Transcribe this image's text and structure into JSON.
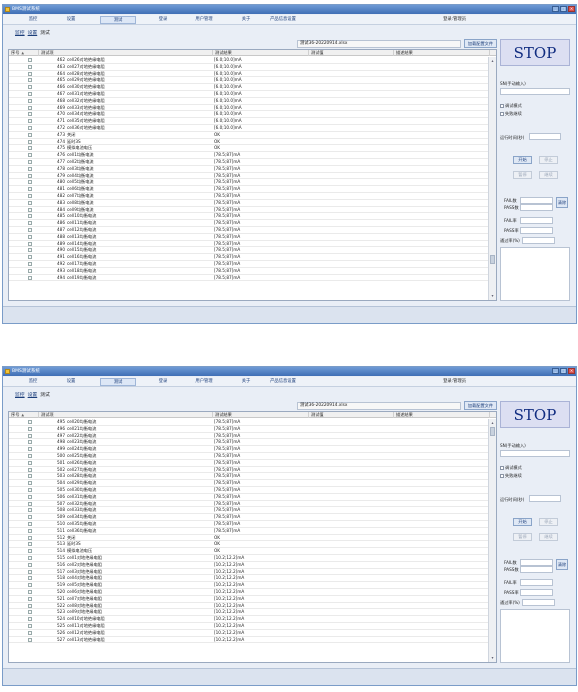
{
  "windows": [
    {
      "title": "BMS测试系统",
      "controls": [
        "_",
        "□",
        "×"
      ],
      "menu": [
        "监控",
        "设置",
        "测试",
        "登录",
        "用户管理",
        "关于",
        "产品信息设置"
      ],
      "active_menu_index": 2,
      "login": "登录:管理员",
      "tabs": [
        "监控",
        "设置",
        "测试"
      ],
      "file": "测试36-20220914.xlsx",
      "load_btn": "加载配置文件",
      "columns": [
        "序号",
        "测试项",
        "测试结果",
        "测试值",
        "描述结果"
      ],
      "rows": [
        {
          "no": "462",
          "name": "cell26对地绝缘电阻",
          "result": "[6.0;10.0]mA"
        },
        {
          "no": "463",
          "name": "cell27对地绝缘电阻",
          "result": "[6.0;10.0]mA"
        },
        {
          "no": "464",
          "name": "cell28对地绝缘电阻",
          "result": "[6.0;10.0]mA"
        },
        {
          "no": "465",
          "name": "cell29对地绝缘电阻",
          "result": "[6.0;10.0]mA"
        },
        {
          "no": "466",
          "name": "cell30对地绝缘电阻",
          "result": "[6.0;10.0]mA"
        },
        {
          "no": "467",
          "name": "cell31对地绝缘电阻",
          "result": "[6.0;10.0]mA"
        },
        {
          "no": "468",
          "name": "cell32对地绝缘电阻",
          "result": "[6.0;10.0]mA"
        },
        {
          "no": "469",
          "name": "cell33对地绝缘电阻",
          "result": "[6.0;10.0]mA"
        },
        {
          "no": "470",
          "name": "cell34对地绝缘电阻",
          "result": "[6.0;10.0]mA"
        },
        {
          "no": "471",
          "name": "cell35对地绝缘电阻",
          "result": "[6.0;10.0]mA"
        },
        {
          "no": "472",
          "name": "cell36对地绝缘电阻",
          "result": "[6.0;10.0]mA"
        },
        {
          "no": "473",
          "name": "关闭",
          "result": "OK"
        },
        {
          "no": "474",
          "name": "延时3S",
          "result": "OK"
        },
        {
          "no": "475",
          "name": "模拟电池电压",
          "result": "OK"
        },
        {
          "no": "476",
          "name": "cell1均衡电流",
          "result": "[78.5;87]mA"
        },
        {
          "no": "477",
          "name": "cell2均衡电流",
          "result": "[78.5;87]mA"
        },
        {
          "no": "478",
          "name": "cell3均衡电流",
          "result": "[78.5;87]mA"
        },
        {
          "no": "479",
          "name": "cell4均衡电流",
          "result": "[78.5;87]mA"
        },
        {
          "no": "480",
          "name": "cell5均衡电流",
          "result": "[78.5;87]mA"
        },
        {
          "no": "481",
          "name": "cell6均衡电流",
          "result": "[78.5;87]mA"
        },
        {
          "no": "482",
          "name": "cell7均衡电流",
          "result": "[78.5;87]mA"
        },
        {
          "no": "483",
          "name": "cell8均衡电流",
          "result": "[78.5;87]mA"
        },
        {
          "no": "484",
          "name": "cell9均衡电流",
          "result": "[78.5;87]mA"
        },
        {
          "no": "485",
          "name": "cell10均衡电流",
          "result": "[78.5;87]mA"
        },
        {
          "no": "486",
          "name": "cell11均衡电流",
          "result": "[78.5;87]mA"
        },
        {
          "no": "487",
          "name": "cell12均衡电流",
          "result": "[78.5;87]mA"
        },
        {
          "no": "488",
          "name": "cell13均衡电流",
          "result": "[78.5;87]mA"
        },
        {
          "no": "489",
          "name": "cell14均衡电流",
          "result": "[78.5;87]mA"
        },
        {
          "no": "490",
          "name": "cell15均衡电流",
          "result": "[78.5;87]mA"
        },
        {
          "no": "491",
          "name": "cell16均衡电流",
          "result": "[78.5;87]mA"
        },
        {
          "no": "492",
          "name": "cell17均衡电流",
          "result": "[78.5;87]mA"
        },
        {
          "no": "493",
          "name": "cell18均衡电流",
          "result": "[78.5;87]mA"
        },
        {
          "no": "494",
          "name": "cell19均衡电流",
          "result": "[78.5;87]mA"
        }
      ],
      "side": {
        "stop": "STOP",
        "sn_label": "SN(手动输入)",
        "checkbox1": "调试模式",
        "checkbox2": "失败继续",
        "op_label": "运行时间(秒)",
        "start": "开始",
        "stop_btn": "停止",
        "pause": "暂停",
        "resume": "继续",
        "fail_count": "FAIL数",
        "pass_count": "PASS数",
        "clear": "清除",
        "fail_rate": "FAIL率",
        "pass_rate": "PASS率",
        "yield": "通过率(%)"
      }
    },
    {
      "title": "BMS测试系统",
      "controls": [
        "_",
        "□",
        "×"
      ],
      "menu": [
        "监控",
        "设置",
        "测试",
        "登录",
        "用户管理",
        "关于",
        "产品信息设置"
      ],
      "active_menu_index": 2,
      "login": "登录:管理员",
      "tabs": [
        "监控",
        "设置",
        "测试"
      ],
      "file": "测试36-20220914.xlsx",
      "load_btn": "加载配置文件",
      "columns": [
        "序号",
        "测试项",
        "测试结果",
        "测试值",
        "描述结果"
      ],
      "rows": [
        {
          "no": "495",
          "name": "cell20均衡电流",
          "result": "[78.5;87]mA"
        },
        {
          "no": "496",
          "name": "cell21均衡电流",
          "result": "[78.5;87]mA"
        },
        {
          "no": "497",
          "name": "cell22均衡电流",
          "result": "[78.5;87]mA"
        },
        {
          "no": "498",
          "name": "cell23均衡电流",
          "result": "[78.5;87]mA"
        },
        {
          "no": "499",
          "name": "cell24均衡电流",
          "result": "[78.5;87]mA"
        },
        {
          "no": "500",
          "name": "cell25均衡电流",
          "result": "[78.5;87]mA"
        },
        {
          "no": "501",
          "name": "cell26均衡电流",
          "result": "[78.5;87]mA"
        },
        {
          "no": "502",
          "name": "cell27均衡电流",
          "result": "[78.5;87]mA"
        },
        {
          "no": "503",
          "name": "cell28均衡电流",
          "result": "[78.5;87]mA"
        },
        {
          "no": "504",
          "name": "cell29均衡电流",
          "result": "[78.5;87]mA"
        },
        {
          "no": "505",
          "name": "cell30均衡电流",
          "result": "[78.5;87]mA"
        },
        {
          "no": "506",
          "name": "cell31均衡电流",
          "result": "[78.5;87]mA"
        },
        {
          "no": "507",
          "name": "cell32均衡电流",
          "result": "[78.5;87]mA"
        },
        {
          "no": "508",
          "name": "cell33均衡电流",
          "result": "[78.5;87]mA"
        },
        {
          "no": "509",
          "name": "cell34均衡电流",
          "result": "[78.5;87]mA"
        },
        {
          "no": "510",
          "name": "cell35均衡电流",
          "result": "[78.5;87]mA"
        },
        {
          "no": "511",
          "name": "cell36均衡电流",
          "result": "[78.5;87]mA"
        },
        {
          "no": "512",
          "name": "关闭",
          "result": "OK"
        },
        {
          "no": "513",
          "name": "延时3S",
          "result": "OK"
        },
        {
          "no": "514",
          "name": "模拟电池电压",
          "result": "OK"
        },
        {
          "no": "515",
          "name": "cell1对地绝缘电阻",
          "result": "[10.2;12.2]mA"
        },
        {
          "no": "516",
          "name": "cell2对地绝缘电阻",
          "result": "[10.2;12.2]mA"
        },
        {
          "no": "517",
          "name": "cell3对地绝缘电阻",
          "result": "[10.2;12.2]mA"
        },
        {
          "no": "518",
          "name": "cell4对地绝缘电阻",
          "result": "[10.2;12.2]mA"
        },
        {
          "no": "519",
          "name": "cell5对地绝缘电阻",
          "result": "[10.2;12.2]mA"
        },
        {
          "no": "520",
          "name": "cell6对地绝缘电阻",
          "result": "[10.2;12.2]mA"
        },
        {
          "no": "521",
          "name": "cell7对地绝缘电阻",
          "result": "[10.2;12.2]mA"
        },
        {
          "no": "522",
          "name": "cell8对地绝缘电阻",
          "result": "[10.2;12.2]mA"
        },
        {
          "no": "523",
          "name": "cell9对地绝缘电阻",
          "result": "[10.2;12.2]mA"
        },
        {
          "no": "524",
          "name": "cell10对地绝缘电阻",
          "result": "[10.2;12.2]mA"
        },
        {
          "no": "525",
          "name": "cell11对地绝缘电阻",
          "result": "[10.2;12.2]mA"
        },
        {
          "no": "526",
          "name": "cell12对地绝缘电阻",
          "result": "[10.2;12.2]mA"
        },
        {
          "no": "527",
          "name": "cell13对地绝缘电阻",
          "result": "[10.2;12.2]mA"
        }
      ],
      "side": {
        "stop": "STOP",
        "sn_label": "SN(手动输入)",
        "checkbox1": "调试模式",
        "checkbox2": "失败继续",
        "op_label": "运行时间(秒)",
        "start": "开始",
        "stop_btn": "停止",
        "pause": "暂停",
        "resume": "继续",
        "fail_count": "FAIL数",
        "pass_count": "PASS数",
        "clear": "清除",
        "fail_rate": "FAIL率",
        "pass_rate": "PASS率",
        "yield": "通过率(%)"
      }
    }
  ]
}
